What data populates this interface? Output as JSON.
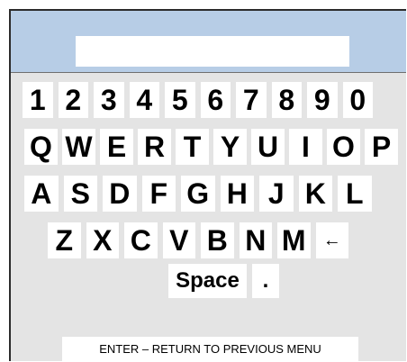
{
  "display": {
    "value": ""
  },
  "keyboard": {
    "digit_row": [
      "1",
      "2",
      "3",
      "4",
      "5",
      "6",
      "7",
      "8",
      "9",
      "0"
    ],
    "row1": [
      "Q",
      "W",
      "E",
      "R",
      "T",
      "Y",
      "U",
      "I",
      "O",
      "P"
    ],
    "row2": [
      "A",
      "S",
      "D",
      "F",
      "G",
      "H",
      "J",
      "K",
      "L"
    ],
    "row3": [
      "Z",
      "X",
      "C",
      "V",
      "B",
      "N",
      "M"
    ],
    "backspace": "←",
    "space": "Space",
    "period": "."
  },
  "footer": {
    "enter_label": "ENTER – RETURN TO PREVIOUS MENU"
  }
}
